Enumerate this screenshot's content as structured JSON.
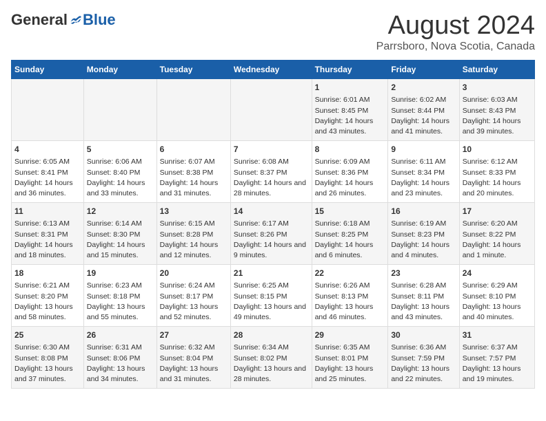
{
  "header": {
    "logo_general": "General",
    "logo_blue": "Blue",
    "month_year": "August 2024",
    "location": "Parrsboro, Nova Scotia, Canada"
  },
  "days_of_week": [
    "Sunday",
    "Monday",
    "Tuesday",
    "Wednesday",
    "Thursday",
    "Friday",
    "Saturday"
  ],
  "weeks": [
    [
      {
        "day": "",
        "content": ""
      },
      {
        "day": "",
        "content": ""
      },
      {
        "day": "",
        "content": ""
      },
      {
        "day": "",
        "content": ""
      },
      {
        "day": "1",
        "sunrise": "Sunrise: 6:01 AM",
        "sunset": "Sunset: 8:45 PM",
        "daylight": "Daylight: 14 hours and 43 minutes."
      },
      {
        "day": "2",
        "sunrise": "Sunrise: 6:02 AM",
        "sunset": "Sunset: 8:44 PM",
        "daylight": "Daylight: 14 hours and 41 minutes."
      },
      {
        "day": "3",
        "sunrise": "Sunrise: 6:03 AM",
        "sunset": "Sunset: 8:43 PM",
        "daylight": "Daylight: 14 hours and 39 minutes."
      }
    ],
    [
      {
        "day": "4",
        "sunrise": "Sunrise: 6:05 AM",
        "sunset": "Sunset: 8:41 PM",
        "daylight": "Daylight: 14 hours and 36 minutes."
      },
      {
        "day": "5",
        "sunrise": "Sunrise: 6:06 AM",
        "sunset": "Sunset: 8:40 PM",
        "daylight": "Daylight: 14 hours and 33 minutes."
      },
      {
        "day": "6",
        "sunrise": "Sunrise: 6:07 AM",
        "sunset": "Sunset: 8:38 PM",
        "daylight": "Daylight: 14 hours and 31 minutes."
      },
      {
        "day": "7",
        "sunrise": "Sunrise: 6:08 AM",
        "sunset": "Sunset: 8:37 PM",
        "daylight": "Daylight: 14 hours and 28 minutes."
      },
      {
        "day": "8",
        "sunrise": "Sunrise: 6:09 AM",
        "sunset": "Sunset: 8:36 PM",
        "daylight": "Daylight: 14 hours and 26 minutes."
      },
      {
        "day": "9",
        "sunrise": "Sunrise: 6:11 AM",
        "sunset": "Sunset: 8:34 PM",
        "daylight": "Daylight: 14 hours and 23 minutes."
      },
      {
        "day": "10",
        "sunrise": "Sunrise: 6:12 AM",
        "sunset": "Sunset: 8:33 PM",
        "daylight": "Daylight: 14 hours and 20 minutes."
      }
    ],
    [
      {
        "day": "11",
        "sunrise": "Sunrise: 6:13 AM",
        "sunset": "Sunset: 8:31 PM",
        "daylight": "Daylight: 14 hours and 18 minutes."
      },
      {
        "day": "12",
        "sunrise": "Sunrise: 6:14 AM",
        "sunset": "Sunset: 8:30 PM",
        "daylight": "Daylight: 14 hours and 15 minutes."
      },
      {
        "day": "13",
        "sunrise": "Sunrise: 6:15 AM",
        "sunset": "Sunset: 8:28 PM",
        "daylight": "Daylight: 14 hours and 12 minutes."
      },
      {
        "day": "14",
        "sunrise": "Sunrise: 6:17 AM",
        "sunset": "Sunset: 8:26 PM",
        "daylight": "Daylight: 14 hours and 9 minutes."
      },
      {
        "day": "15",
        "sunrise": "Sunrise: 6:18 AM",
        "sunset": "Sunset: 8:25 PM",
        "daylight": "Daylight: 14 hours and 6 minutes."
      },
      {
        "day": "16",
        "sunrise": "Sunrise: 6:19 AM",
        "sunset": "Sunset: 8:23 PM",
        "daylight": "Daylight: 14 hours and 4 minutes."
      },
      {
        "day": "17",
        "sunrise": "Sunrise: 6:20 AM",
        "sunset": "Sunset: 8:22 PM",
        "daylight": "Daylight: 14 hours and 1 minute."
      }
    ],
    [
      {
        "day": "18",
        "sunrise": "Sunrise: 6:21 AM",
        "sunset": "Sunset: 8:20 PM",
        "daylight": "Daylight: 13 hours and 58 minutes."
      },
      {
        "day": "19",
        "sunrise": "Sunrise: 6:23 AM",
        "sunset": "Sunset: 8:18 PM",
        "daylight": "Daylight: 13 hours and 55 minutes."
      },
      {
        "day": "20",
        "sunrise": "Sunrise: 6:24 AM",
        "sunset": "Sunset: 8:17 PM",
        "daylight": "Daylight: 13 hours and 52 minutes."
      },
      {
        "day": "21",
        "sunrise": "Sunrise: 6:25 AM",
        "sunset": "Sunset: 8:15 PM",
        "daylight": "Daylight: 13 hours and 49 minutes."
      },
      {
        "day": "22",
        "sunrise": "Sunrise: 6:26 AM",
        "sunset": "Sunset: 8:13 PM",
        "daylight": "Daylight: 13 hours and 46 minutes."
      },
      {
        "day": "23",
        "sunrise": "Sunrise: 6:28 AM",
        "sunset": "Sunset: 8:11 PM",
        "daylight": "Daylight: 13 hours and 43 minutes."
      },
      {
        "day": "24",
        "sunrise": "Sunrise: 6:29 AM",
        "sunset": "Sunset: 8:10 PM",
        "daylight": "Daylight: 13 hours and 40 minutes."
      }
    ],
    [
      {
        "day": "25",
        "sunrise": "Sunrise: 6:30 AM",
        "sunset": "Sunset: 8:08 PM",
        "daylight": "Daylight: 13 hours and 37 minutes."
      },
      {
        "day": "26",
        "sunrise": "Sunrise: 6:31 AM",
        "sunset": "Sunset: 8:06 PM",
        "daylight": "Daylight: 13 hours and 34 minutes."
      },
      {
        "day": "27",
        "sunrise": "Sunrise: 6:32 AM",
        "sunset": "Sunset: 8:04 PM",
        "daylight": "Daylight: 13 hours and 31 minutes."
      },
      {
        "day": "28",
        "sunrise": "Sunrise: 6:34 AM",
        "sunset": "Sunset: 8:02 PM",
        "daylight": "Daylight: 13 hours and 28 minutes."
      },
      {
        "day": "29",
        "sunrise": "Sunrise: 6:35 AM",
        "sunset": "Sunset: 8:01 PM",
        "daylight": "Daylight: 13 hours and 25 minutes."
      },
      {
        "day": "30",
        "sunrise": "Sunrise: 6:36 AM",
        "sunset": "Sunset: 7:59 PM",
        "daylight": "Daylight: 13 hours and 22 minutes."
      },
      {
        "day": "31",
        "sunrise": "Sunrise: 6:37 AM",
        "sunset": "Sunset: 7:57 PM",
        "daylight": "Daylight: 13 hours and 19 minutes."
      }
    ]
  ]
}
